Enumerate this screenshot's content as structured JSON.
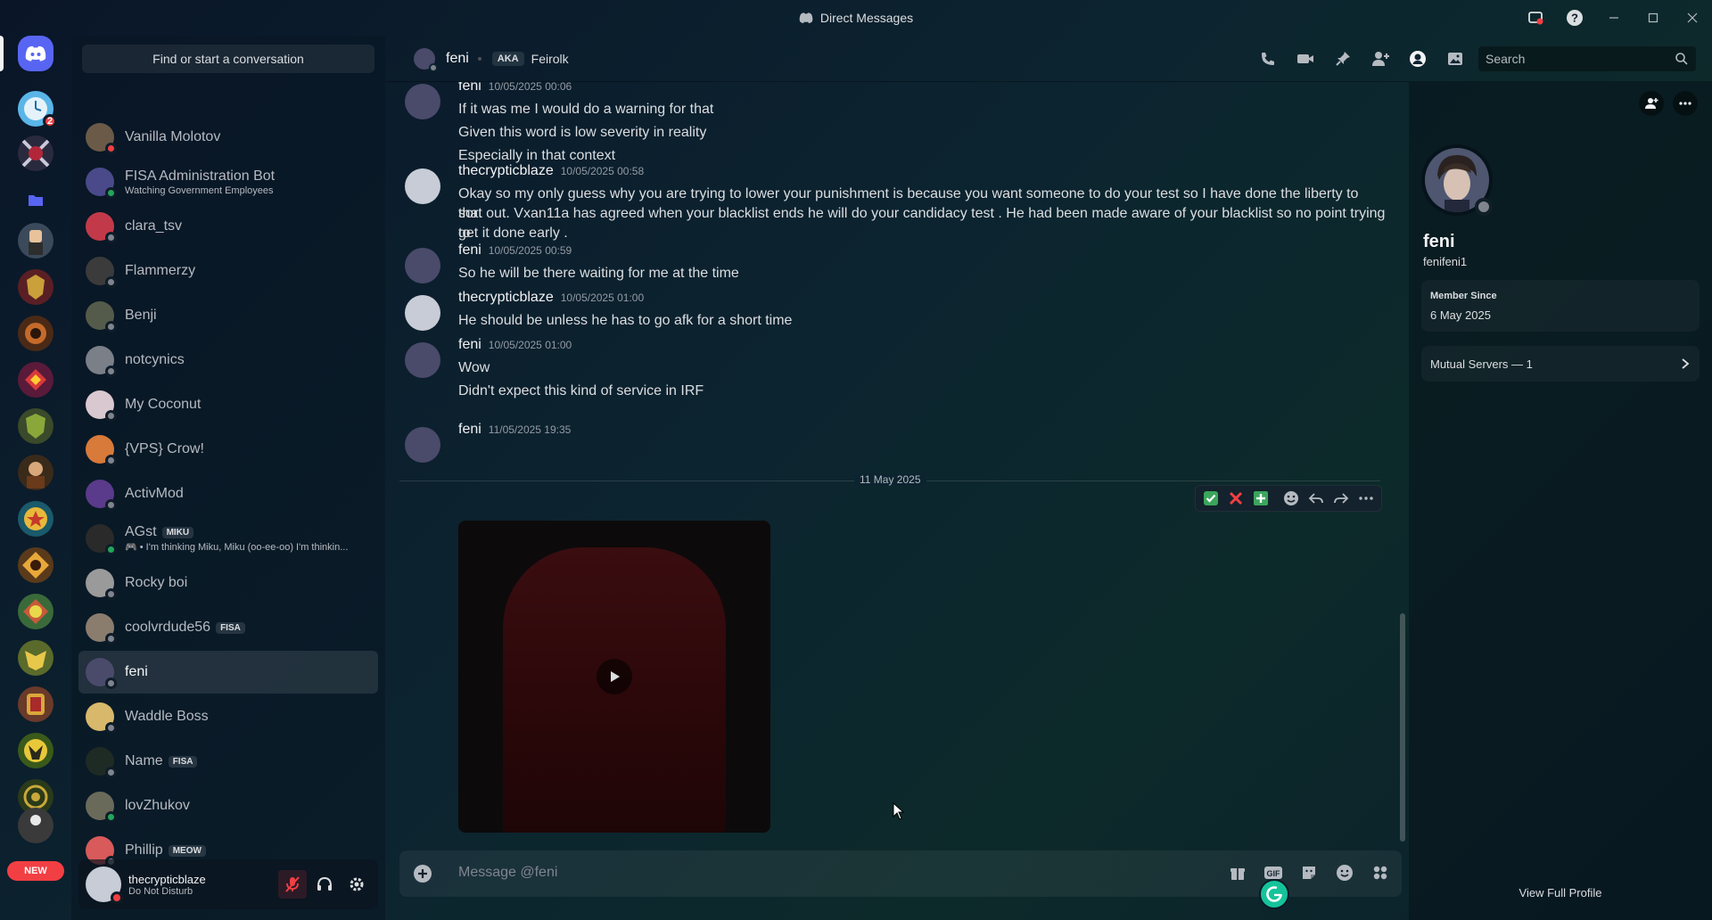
{
  "window": {
    "title": "Direct Messages"
  },
  "colors": {
    "accent": "#5865f2",
    "online": "#23a55a",
    "dnd": "#f23f43",
    "offline": "#80848e"
  },
  "rail": {
    "home_badge": "2",
    "new_label": "NEW"
  },
  "sidebar": {
    "search_placeholder": "Find or start a conversation",
    "dms": [
      {
        "name": "Vanilla Molotov",
        "status": "dnd",
        "color": "#6b5a48"
      },
      {
        "name": "FISA Administration Bot",
        "sub": "Watching Government Employees",
        "status": "online",
        "color": "#4a4a8a"
      },
      {
        "name": "clara_tsv",
        "status": "offline",
        "color": "#c23a4a"
      },
      {
        "name": "Flammerzy",
        "status": "offline",
        "color": "#3b3b3b"
      },
      {
        "name": "Benji",
        "status": "offline",
        "color": "#555b4a"
      },
      {
        "name": "notcynics",
        "status": "offline",
        "color": "#7a7f88"
      },
      {
        "name": "My Coconut",
        "status": "offline",
        "color": "#d9c8cf"
      },
      {
        "name": "{VPS} Crow!",
        "status": "offline",
        "color": "#d77a3a"
      },
      {
        "name": "ActivMod",
        "status": "offline",
        "color": "#5a3a8a"
      },
      {
        "name": "AGst",
        "tag": "MIKU",
        "sub": "🎮 • I'm thinking Miku, Miku (oo-ee-oo) I'm thinkin...",
        "status": "online",
        "color": "#2a2a2a"
      },
      {
        "name": "Rocky boi",
        "status": "offline",
        "color": "#9a9a9a"
      },
      {
        "name": "coolvrdude56",
        "tag": "FISA",
        "status": "offline",
        "color": "#8a7d6e"
      },
      {
        "name": "feni",
        "status": "offline",
        "color": "#4a4a6a",
        "active": true
      },
      {
        "name": "Waddle Boss",
        "status": "offline",
        "color": "#d8b86a"
      },
      {
        "name": "Name",
        "tag": "FISA",
        "status": "offline",
        "color": "#1e2a24"
      },
      {
        "name": "lovZhukov",
        "status": "online",
        "color": "#6a6a5a"
      },
      {
        "name": "Phillip",
        "tag": "MEOW",
        "status": "offline",
        "color": "#d85a5a"
      }
    ]
  },
  "user": {
    "name": "thecrypticblaze",
    "status_text": "Do Not Disturb"
  },
  "header": {
    "name": "feni",
    "aka_label": "AKA",
    "aka_name": "Feirolk",
    "search_placeholder": "Search"
  },
  "messages": [
    {
      "author": "feni",
      "time": "10/05/2025 00:06",
      "lines": [
        "If it was me I would do a warning for that",
        "Given this word is low severity in reality",
        "Especially in that context"
      ]
    },
    {
      "author": "thecrypticblaze",
      "time": "10/05/2025 00:58",
      "lines": [
        "Okay so my only guess why you are trying to lower your punishment is because you want someone to do your test so I have done the liberty to sort",
        "that out. Vxan11a has agreed when your blacklist ends he will do your candidacy test . He had been made aware of your blacklist so no point trying to",
        "get it done early ."
      ]
    },
    {
      "author": "feni",
      "time": "10/05/2025 00:59",
      "lines": [
        "So he will be there waiting for me at the time"
      ]
    },
    {
      "author": "thecrypticblaze",
      "time": "10/05/2025 01:00",
      "lines": [
        "He should be unless he has to go afk for a short time"
      ]
    },
    {
      "author": "feni",
      "time": "10/05/2025 01:00",
      "lines": [
        "Wow",
        "Didn't expect this kind of service in IRF"
      ]
    },
    {
      "author": "feni",
      "time": "11/05/2025 19:35",
      "lines": []
    }
  ],
  "date_divider": "11 May 2025",
  "composer": {
    "placeholder": "Message @feni"
  },
  "profile": {
    "display_name": "feni",
    "username": "fenifeni1",
    "member_since_label": "Member Since",
    "member_since": "6 May 2025",
    "mutual_servers": "Mutual Servers — 1",
    "view_full": "View Full Profile"
  }
}
